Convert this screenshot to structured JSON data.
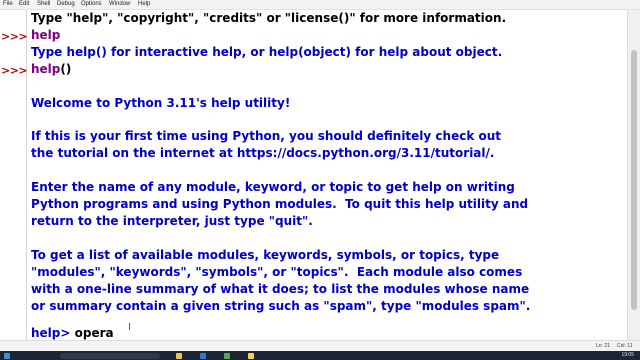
{
  "menu": [
    "File",
    "Edit",
    "Shell",
    "Debug",
    "Options",
    "Window",
    "Help"
  ],
  "prompts": [
    ">>>",
    ">>>"
  ],
  "lines": {
    "intro": "Type \"help\", \"copyright\", \"credits\" or \"license()\" for more information.",
    "cmd1": "help",
    "cmd1_out": "Type help() for interactive help, or help(object) for help about object.",
    "cmd2_name": "help",
    "cmd2_parens": "()",
    "welcome": "Welcome to Python 3.11's help utility!",
    "p1_l1": "If this is your first time using Python, you should definitely check out",
    "p1_l2": "the tutorial on the internet at https://docs.python.org/3.11/tutorial/.",
    "p2_l1": "Enter the name of any module, keyword, or topic to get help on writing",
    "p2_l2": "Python programs and using Python modules.  To quit this help utility and",
    "p2_l3": "return to the interpreter, just type \"quit\".",
    "p3_l1": "To get a list of available modules, keywords, symbols, or topics, type",
    "p3_l2": "\"modules\", \"keywords\", \"symbols\", or \"topics\".  Each module also comes",
    "p3_l3": "with a one-line summary of what it does; to list the modules whose name",
    "p3_l4": "or summary contain a given string such as \"spam\", type \"modules spam\".",
    "help_prompt": "help> ",
    "help_input": "opera"
  },
  "status": {
    "line": "Ln: 21",
    "col": "Col: 11"
  },
  "clock": "19:05"
}
